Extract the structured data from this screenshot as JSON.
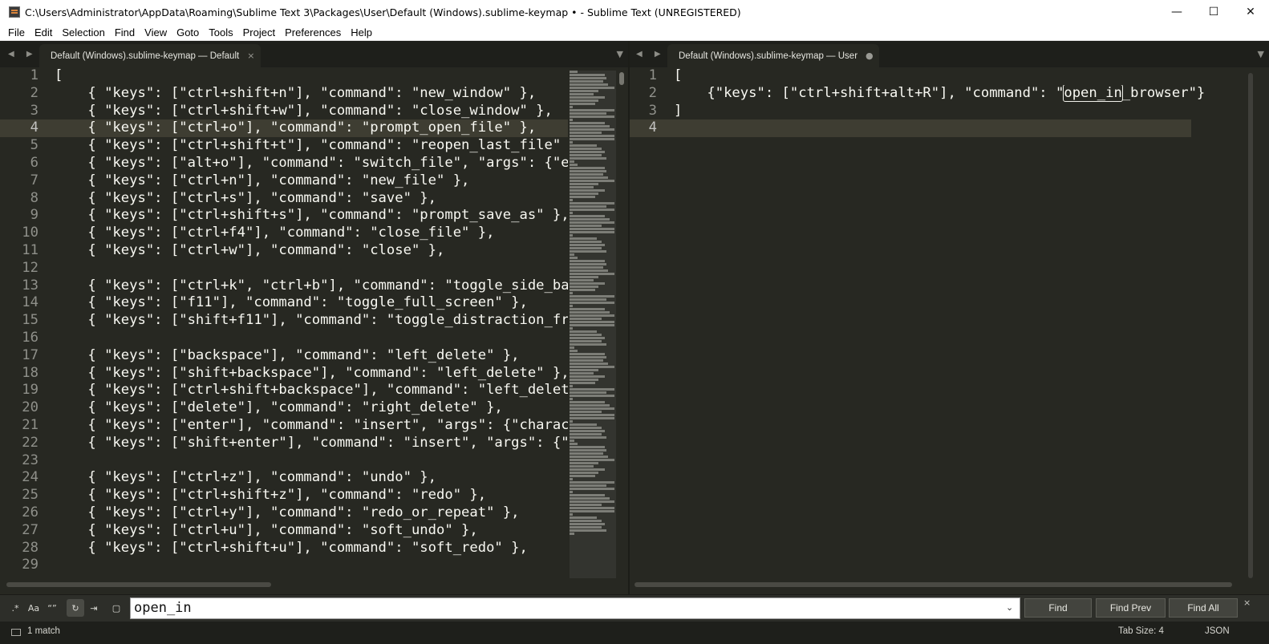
{
  "window": {
    "title": "C:\\Users\\Administrator\\AppData\\Roaming\\Sublime Text 3\\Packages\\User\\Default (Windows).sublime-keymap • - Sublime Text (UNREGISTERED)",
    "minimize": "—",
    "maximize": "☐",
    "close": "✕"
  },
  "menu": [
    "File",
    "Edit",
    "Selection",
    "Find",
    "View",
    "Goto",
    "Tools",
    "Project",
    "Preferences",
    "Help"
  ],
  "left_pane": {
    "tab_label": "Default (Windows).sublime-keymap — Default",
    "tab_close": "×",
    "nav": "◀ ▶",
    "tab_menu": "▼",
    "current_line": 4,
    "lines": [
      {
        "n": "1",
        "t": "["
      },
      {
        "n": "2",
        "t": "    { \"keys\": [\"ctrl+shift+n\"], \"command\": \"new_window\" },"
      },
      {
        "n": "3",
        "t": "    { \"keys\": [\"ctrl+shift+w\"], \"command\": \"close_window\" },"
      },
      {
        "n": "4",
        "t": "    { \"keys\": [\"ctrl+o\"], \"command\": \"prompt_open_file\" },"
      },
      {
        "n": "5",
        "t": "    { \"keys\": [\"ctrl+shift+t\"], \"command\": \"reopen_last_file\" },"
      },
      {
        "n": "6",
        "t": "    { \"keys\": [\"alt+o\"], \"command\": \"switch_file\", \"args\": {\"exte"
      },
      {
        "n": "7",
        "t": "    { \"keys\": [\"ctrl+n\"], \"command\": \"new_file\" },"
      },
      {
        "n": "8",
        "t": "    { \"keys\": [\"ctrl+s\"], \"command\": \"save\" },"
      },
      {
        "n": "9",
        "t": "    { \"keys\": [\"ctrl+shift+s\"], \"command\": \"prompt_save_as\" },"
      },
      {
        "n": "10",
        "t": "    { \"keys\": [\"ctrl+f4\"], \"command\": \"close_file\" },"
      },
      {
        "n": "11",
        "t": "    { \"keys\": [\"ctrl+w\"], \"command\": \"close\" },"
      },
      {
        "n": "12",
        "t": ""
      },
      {
        "n": "13",
        "t": "    { \"keys\": [\"ctrl+k\", \"ctrl+b\"], \"command\": \"toggle_side_bar\""
      },
      {
        "n": "14",
        "t": "    { \"keys\": [\"f11\"], \"command\": \"toggle_full_screen\" },"
      },
      {
        "n": "15",
        "t": "    { \"keys\": [\"shift+f11\"], \"command\": \"toggle_distraction_free\""
      },
      {
        "n": "16",
        "t": ""
      },
      {
        "n": "17",
        "t": "    { \"keys\": [\"backspace\"], \"command\": \"left_delete\" },"
      },
      {
        "n": "18",
        "t": "    { \"keys\": [\"shift+backspace\"], \"command\": \"left_delete\" },"
      },
      {
        "n": "19",
        "t": "    { \"keys\": [\"ctrl+shift+backspace\"], \"command\": \"left_delete\""
      },
      {
        "n": "20",
        "t": "    { \"keys\": [\"delete\"], \"command\": \"right_delete\" },"
      },
      {
        "n": "21",
        "t": "    { \"keys\": [\"enter\"], \"command\": \"insert\", \"args\": {\"character"
      },
      {
        "n": "22",
        "t": "    { \"keys\": [\"shift+enter\"], \"command\": \"insert\", \"args\": {\"cha"
      },
      {
        "n": "23",
        "t": ""
      },
      {
        "n": "24",
        "t": "    { \"keys\": [\"ctrl+z\"], \"command\": \"undo\" },"
      },
      {
        "n": "25",
        "t": "    { \"keys\": [\"ctrl+shift+z\"], \"command\": \"redo\" },"
      },
      {
        "n": "26",
        "t": "    { \"keys\": [\"ctrl+y\"], \"command\": \"redo_or_repeat\" },"
      },
      {
        "n": "27",
        "t": "    { \"keys\": [\"ctrl+u\"], \"command\": \"soft_undo\" },"
      },
      {
        "n": "28",
        "t": "    { \"keys\": [\"ctrl+shift+u\"], \"command\": \"soft_redo\" },"
      },
      {
        "n": "29",
        "t": ""
      }
    ]
  },
  "right_pane": {
    "tab_label": "Default (Windows).sublime-keymap — User",
    "tab_dirty": "●",
    "nav": "◀ ▶",
    "tab_menu": "▼",
    "current_line": 4,
    "lines": [
      {
        "n": "1",
        "t": "["
      },
      {
        "n": "2",
        "t": "    {\"keys\": [\"ctrl+shift+alt+R\"], \"command\": \"",
        "match": "open_in",
        "after": "_browser\"}"
      },
      {
        "n": "3",
        "t": "]"
      },
      {
        "n": "4",
        "t": ""
      }
    ]
  },
  "find_panel": {
    "options": [
      {
        "name": "regex-toggle",
        "glyph": ".*",
        "on": false
      },
      {
        "name": "case-sensitive-toggle",
        "glyph": "Aa",
        "on": false
      },
      {
        "name": "whole-word-toggle",
        "glyph": "“”",
        "on": false
      },
      {
        "name": "wrap-toggle",
        "glyph": "↻",
        "on": true
      },
      {
        "name": "in-selection-toggle",
        "glyph": "⇥",
        "on": false
      },
      {
        "name": "highlight-matches-toggle",
        "glyph": "▢",
        "on": false
      }
    ],
    "query": "open_in",
    "dropdown": "⌄",
    "find_label": "Find",
    "find_prev_label": "Find Prev",
    "find_all_label": "Find All",
    "close": "×"
  },
  "status_bar": {
    "message": "1 match",
    "tab_size": "Tab Size: 4",
    "syntax": "JSON"
  }
}
